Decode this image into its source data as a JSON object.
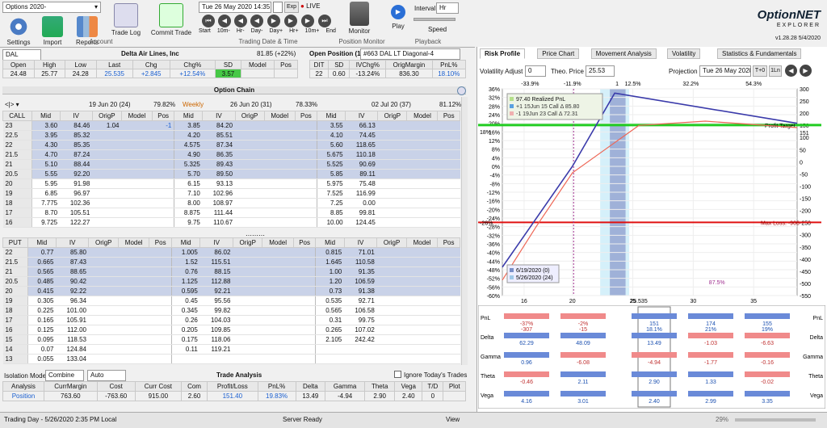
{
  "toolbar": {
    "strategy_select": "Options 2020-",
    "settings": "Settings",
    "import": "Import",
    "reports": "Reports",
    "trade_log": "Trade Log",
    "commit_trade": "Commit Trade",
    "group_account": "Account",
    "date_field": "Tue 26 May  2020  14:35",
    "exp_label": "Exp",
    "live_label": "LIVE",
    "start": "Start",
    "10m": "10m-",
    "hr_minus": "Hr-",
    "day_minus": "Day-",
    "day_plus": "Day+",
    "hr_plus": "Hr+",
    "10m_plus": "10m+",
    "end": "End",
    "group_trading": "Trading Date & Time",
    "monitor": "Monitor",
    "group_position": "Position Monitor",
    "play": "Play",
    "interval_label": "Interval",
    "interval_value": "Hr",
    "speed": "Speed",
    "group_playback": "Playback",
    "brand1": "OptionNET",
    "brand2": "EXPLORER",
    "version": "v1.28.28  5/4/2020"
  },
  "quote": {
    "symbol": "DAL",
    "name": "Delta Air Lines, Inc",
    "change_text": "81.85 (+22%)",
    "headers": [
      "Open",
      "High",
      "Low",
      "Last",
      "Chg",
      "Chg%",
      "SD",
      "Model",
      "Pos"
    ],
    "values": [
      "24.48",
      "25.77",
      "24.28",
      "25.535",
      "+2.845",
      "+12.54%",
      "3.57",
      "",
      ""
    ]
  },
  "open_position": {
    "label": "Open Position (1)",
    "name": "#663 DAL LT Diagonal-4",
    "headers": [
      "DIT",
      "SD",
      "IVChg%",
      "OrigMargin",
      "PnL%"
    ],
    "values": [
      "22",
      "0.60",
      "-13.24%",
      "836.30",
      "18.10%"
    ]
  },
  "chain": {
    "title": "Option Chain",
    "exp1": "19 Jun 20 (24)",
    "exp1_pct": "79.82%",
    "weekly": "Weekly",
    "exp2": "26 Jun 20 (31)",
    "exp2_pct": "78.33%",
    "exp3": "02 Jul 20 (37)",
    "exp3_pct": "81.12%",
    "cols1": [
      "Mid",
      "IV",
      "OrigP",
      "Model",
      "Pos"
    ],
    "cols2": [
      "Mid",
      "IV",
      "OrigP",
      "Model",
      "Pos"
    ],
    "cols3": [
      "Mid",
      "IV",
      "OrigP",
      "Model",
      "Pos"
    ],
    "call_label": "CALL",
    "put_label": "PUT",
    "calls": [
      [
        "23",
        "3.60",
        "84.46",
        "1.04",
        "",
        "-1",
        "3.85",
        "84.20",
        "",
        "",
        "",
        "3.55",
        "66.13"
      ],
      [
        "22.5",
        "3.95",
        "85.32",
        "",
        "",
        "",
        "4.20",
        "85.51",
        "",
        "",
        "",
        "4.10",
        "74.45"
      ],
      [
        "22",
        "4.30",
        "85.35",
        "",
        "",
        "",
        "4.575",
        "87.34",
        "",
        "",
        "",
        "5.60",
        "118.65"
      ],
      [
        "21.5",
        "4.70",
        "87.24",
        "",
        "",
        "",
        "4.90",
        "86.35",
        "",
        "",
        "",
        "5.675",
        "110.18"
      ],
      [
        "21",
        "5.10",
        "88.44",
        "",
        "",
        "",
        "5.325",
        "89.43",
        "",
        "",
        "",
        "5.525",
        "90.69"
      ],
      [
        "20.5",
        "5.55",
        "92.20",
        "",
        "",
        "",
        "5.70",
        "89.50",
        "",
        "",
        "",
        "5.85",
        "89.11"
      ],
      [
        "20",
        "5.95",
        "91.98",
        "",
        "",
        "",
        "6.15",
        "93.13",
        "",
        "",
        "",
        "5.975",
        "75.48"
      ],
      [
        "19",
        "6.85",
        "96.97",
        "",
        "",
        "",
        "7.10",
        "102.96",
        "",
        "",
        "",
        "7.525",
        "116.99"
      ],
      [
        "18",
        "7.775",
        "102.36",
        "",
        "",
        "",
        "8.00",
        "108.97",
        "",
        "",
        "",
        "7.25",
        "0.00"
      ],
      [
        "17",
        "8.70",
        "105.51",
        "",
        "",
        "",
        "8.875",
        "111.44",
        "",
        "",
        "",
        "8.85",
        "99.81"
      ],
      [
        "16",
        "9.725",
        "122.27",
        "",
        "",
        "",
        "9.75",
        "110.67",
        "",
        "",
        "",
        "10.00",
        "124.45"
      ]
    ],
    "puts": [
      [
        "22",
        "0.77",
        "85.80",
        "",
        "",
        "",
        "1.005",
        "86.02",
        "",
        "",
        "",
        "0.815",
        "71.01"
      ],
      [
        "21.5",
        "0.665",
        "87.43",
        "",
        "",
        "",
        "1.52",
        "115.51",
        "",
        "",
        "",
        "1.645",
        "110.58"
      ],
      [
        "21",
        "0.565",
        "88.65",
        "",
        "",
        "",
        "0.76",
        "88.15",
        "",
        "",
        "",
        "1.00",
        "91.35"
      ],
      [
        "20.5",
        "0.485",
        "90.42",
        "",
        "",
        "",
        "1.125",
        "112.88",
        "",
        "",
        "",
        "1.20",
        "106.59"
      ],
      [
        "20",
        "0.415",
        "92.22",
        "",
        "",
        "",
        "0.595",
        "92.21",
        "",
        "",
        "",
        "0.73",
        "91.38"
      ],
      [
        "19",
        "0.305",
        "96.34",
        "",
        "",
        "",
        "0.45",
        "95.56",
        "",
        "",
        "",
        "0.535",
        "92.71"
      ],
      [
        "18",
        "0.225",
        "101.00",
        "",
        "",
        "",
        "0.345",
        "99.82",
        "",
        "",
        "",
        "0.565",
        "106.58"
      ],
      [
        "17",
        "0.165",
        "105.91",
        "",
        "",
        "",
        "0.26",
        "104.03",
        "",
        "",
        "",
        "0.31",
        "99.75"
      ],
      [
        "16",
        "0.125",
        "112.00",
        "",
        "",
        "",
        "0.205",
        "109.85",
        "",
        "",
        "",
        "0.265",
        "107.02"
      ],
      [
        "15",
        "0.095",
        "118.53",
        "",
        "",
        "",
        "0.175",
        "118.06",
        "",
        "",
        "",
        "2.105",
        "242.42"
      ],
      [
        "14",
        "0.07",
        "124.84",
        "",
        "",
        "",
        "0.11",
        "119.21",
        "",
        "",
        "",
        "",
        ""
      ],
      [
        "13",
        "0.055",
        "133.04",
        "",
        "",
        "",
        "",
        "",
        "",
        "",
        "",
        "",
        ""
      ]
    ]
  },
  "trade": {
    "title": "Trade Analysis",
    "iso_label": "Isolation Mode",
    "iso_value": "Combine",
    "auto_value": "Auto",
    "ignore_label": "Ignore Today's Trades",
    "headers": [
      "Analysis",
      "CurrMargin",
      "Cost",
      "Curr Cost",
      "Com",
      "Profit/Loss",
      "PnL%",
      "Delta",
      "Gamma",
      "Theta",
      "Vega",
      "T/D",
      "Plot"
    ],
    "row": [
      "Position",
      "763.60",
      "-763.60",
      "915.00",
      "2.60",
      "151.40",
      "19.83%",
      "13.49",
      "-4.94",
      "2.90",
      "2.40",
      "0",
      ""
    ]
  },
  "right": {
    "tabs": [
      "Risk Profile",
      "Price Chart",
      "Movement Analysis",
      "Volatility",
      "Statistics & Fundamentals"
    ],
    "vol_adj_label": "Volatility Adjust",
    "vol_adj_value": "0",
    "theo_label": "Theo. Price",
    "theo_value": "25.53",
    "projection_label": "Projection",
    "projection_value": "Tue 26 May  2020",
    "t0_label": "T+0",
    "ln_label": "1Ln"
  },
  "chart_data": {
    "type": "line",
    "x_ticks": [
      "16",
      "20",
      "25",
      "30",
      "35"
    ],
    "left_ticks": [
      "36%",
      "32%",
      "28%",
      "24%",
      "20%",
      "16%",
      "12%",
      "8%",
      "4%",
      "0%",
      "-4%",
      "-8%",
      "-12%",
      "-16%",
      "-20%",
      "-24%",
      "-28%",
      "-32%",
      "-36%",
      "-40%",
      "-44%",
      "-48%",
      "-52%",
      "-56%",
      "-60%"
    ],
    "right_ticks": [
      "300",
      "250",
      "200",
      "150",
      "100",
      "50",
      "0",
      "-50",
      "-100",
      "-150",
      "-200",
      "-250",
      "-300",
      "-350",
      "-400",
      "-450",
      "-500",
      "-550"
    ],
    "top_ticks": [
      "-33.9%",
      "-11.9%",
      "12.5%",
      "32.2%",
      "54.3%"
    ],
    "top_box": "1",
    "profit_target": "Profit Target",
    "profit_value": "151",
    "left_value": "18%",
    "max_loss": "Max Loss: -906",
    "left_loss": "-26%",
    "legend": [
      "97.40 Realized PnL",
      "+1 15Jun 15 Call Δ  85.80",
      "-1 19Jun 23 Call Δ  72.31"
    ],
    "legend2": [
      "6/19/2020 (0)",
      "5/26/2020 (24)"
    ],
    "pct_label": "87.5%",
    "price_marker": "25.535",
    "ylim_pct": [
      -60,
      36
    ],
    "ylim_pnl": [
      -550,
      300
    ],
    "xlim": [
      14.2,
      38.6
    ],
    "t_expiry": {
      "x": [
        14.2,
        20.0,
        23.5,
        38.6
      ],
      "y": [
        -46.8,
        0,
        34,
        20
      ]
    },
    "t_now": {
      "x": [
        14.2,
        17,
        20,
        25.5,
        31,
        38.6
      ],
      "y": [
        -52.8,
        -28,
        -3,
        19,
        21,
        18
      ]
    }
  },
  "greeks": {
    "pnl": {
      "l1": "-37%",
      "l1b": "-307",
      "l2": "-2%",
      "l2b": "-15",
      "c1": "151",
      "c2": "18.1%",
      "r1": "174",
      "r1b": "21%",
      "r2": "155",
      "r2b": "19%"
    },
    "delta": {
      "l1": "62.29",
      "l2": "48.09",
      "c": "13.49",
      "r1": "-1.03",
      "r2": "-6.63"
    },
    "gamma": {
      "l1": "0.96",
      "l2": "-6.08",
      "c": "-4.94",
      "r1": "-1.77",
      "r2": "-0.16"
    },
    "theta": {
      "l1": "-0.46",
      "l2": "2.11",
      "c": "2.90",
      "r1": "1.33",
      "r2": "-0.02"
    },
    "vega": {
      "l1": "4.16",
      "l2": "3.01",
      "c": "2.40",
      "r1": "2.99",
      "r2": "3.35"
    },
    "labels": [
      "PnL",
      "Delta",
      "Gamma",
      "Theta",
      "Vega"
    ]
  },
  "status": {
    "left": "Trading Day - 5/26/2020 2:35 PM Local",
    "mid": "Server Ready",
    "view": "View",
    "zoom": "29%"
  }
}
